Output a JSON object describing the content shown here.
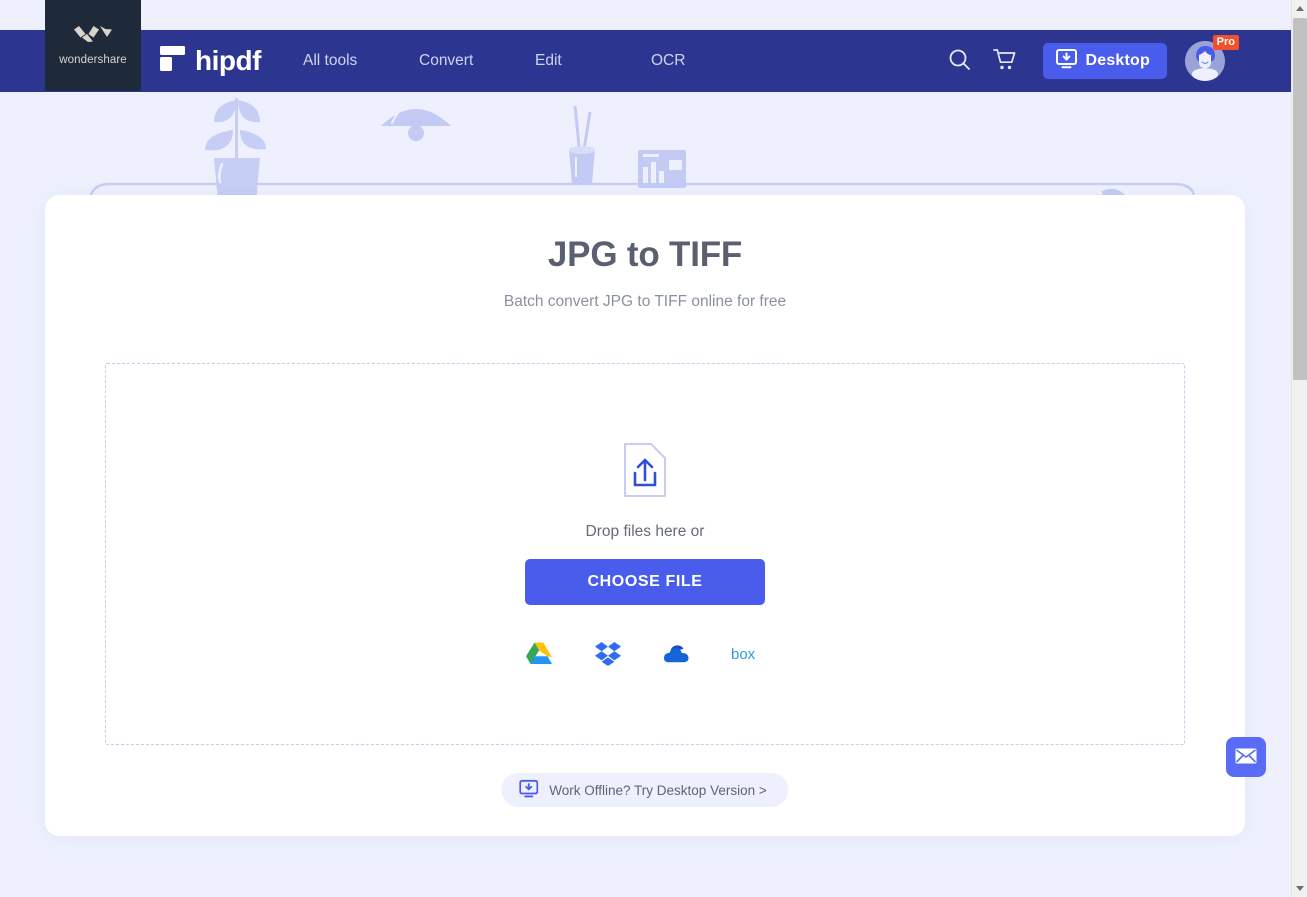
{
  "brand": {
    "wondershare_label": "wondershare",
    "wondershare_icon": "wondershare-w-logo-icon",
    "hipdf_label": "hipdf",
    "hipdf_icon": "hipdf-mark-icon"
  },
  "nav": {
    "links": [
      {
        "label": "All tools",
        "name": "nav-link-all-tools"
      },
      {
        "label": "Convert",
        "name": "nav-link-convert"
      },
      {
        "label": "Edit",
        "name": "nav-link-edit"
      },
      {
        "label": "OCR",
        "name": "nav-link-ocr"
      }
    ],
    "search_icon": "search-icon",
    "cart_icon": "shopping-cart-icon",
    "desktop_button_label": "Desktop",
    "desktop_button_icon": "download-to-monitor-icon",
    "avatar_icon": "user-avatar-icon",
    "pro_badge_label": "Pro"
  },
  "main": {
    "title": "JPG to TIFF",
    "subtitle": "Batch convert JPG to TIFF online for free",
    "dropzone": {
      "upload_icon": "file-upload-icon",
      "drop_text": "Drop files here or",
      "choose_file_label": "CHOOSE FILE",
      "cloud_sources": [
        {
          "label": "Google Drive",
          "name": "google-drive-icon"
        },
        {
          "label": "Dropbox",
          "name": "dropbox-icon"
        },
        {
          "label": "OneDrive",
          "name": "onedrive-icon"
        },
        {
          "label": "Box",
          "name": "box-icon"
        }
      ]
    },
    "offline_pill": {
      "label": "Work Offline? Try Desktop Version >",
      "icon": "download-to-monitor-icon"
    }
  },
  "floating": {
    "mail_icon": "envelope-icon",
    "mail_label": "Contact support"
  },
  "scrollbar": {
    "up_arrow": "scroll-up-arrow-icon",
    "down_arrow": "scroll-down-arrow-icon"
  },
  "colors": {
    "navbar": "#2c3690",
    "wondershare_block": "#1e2a3a",
    "accent": "#4a5ceb",
    "page_background": "#eef1fd",
    "card": "#ffffff",
    "pro_badge": "#f2502c",
    "illustration": "#c3cbf5"
  }
}
